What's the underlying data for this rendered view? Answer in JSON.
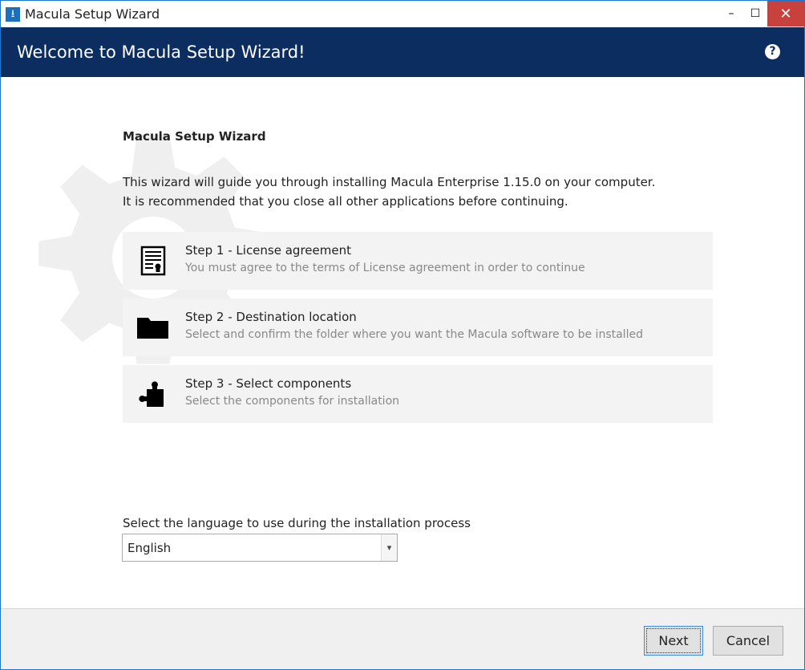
{
  "window": {
    "title": "Macula Setup Wizard",
    "minimize": "–",
    "maximize": "☐",
    "close": "✕"
  },
  "header": {
    "title": "Welcome to Macula Setup Wizard!",
    "help": "?"
  },
  "main": {
    "heading": "Macula Setup Wizard",
    "intro_line1": "This wizard will guide you through installing Macula Enterprise 1.15.0 on your computer.",
    "intro_line2": "It is recommended that you close all other applications before continuing.",
    "steps": [
      {
        "title": "Step 1 - License agreement",
        "subtitle": "You must agree to the terms of License agreement in order to continue",
        "icon": "certificate-document-icon"
      },
      {
        "title": "Step 2 - Destination location",
        "subtitle": "Select and confirm the folder where you want the Macula software to be installed",
        "icon": "folder-icon"
      },
      {
        "title": "Step 3 - Select components",
        "subtitle": "Select the components for installation",
        "icon": "puzzle-piece-icon"
      }
    ],
    "language_label": "Select the language to use during the installation process",
    "language_value": "English"
  },
  "footer": {
    "next": "Next",
    "cancel": "Cancel"
  }
}
